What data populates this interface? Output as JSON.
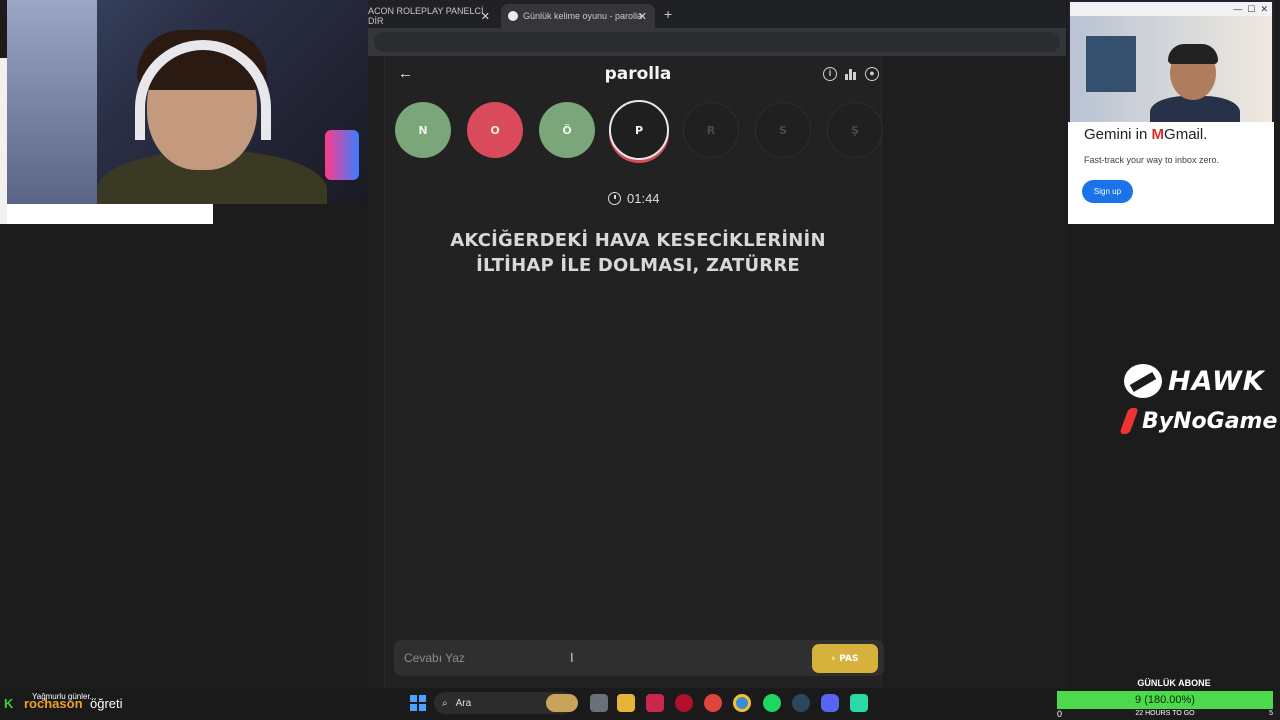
{
  "browser": {
    "tabs": [
      {
        "label": "ACON ROLEPLAY PANELCİ DİR"
      },
      {
        "label": "Günlük kelime oyunu - parolla"
      }
    ],
    "new_tab": "+"
  },
  "game": {
    "title": "parolla",
    "letters": [
      {
        "char": "N",
        "state": "correct"
      },
      {
        "char": "O",
        "state": "wrong"
      },
      {
        "char": "Ö",
        "state": "correct"
      },
      {
        "char": "P",
        "state": "current"
      },
      {
        "char": "R",
        "state": "pending"
      },
      {
        "char": "S",
        "state": "pending"
      },
      {
        "char": "Ş",
        "state": "pending"
      }
    ],
    "timer": "01:44",
    "question_line1": "AKCİĞERDEKİ HAVA KESECİKLERİNİN",
    "question_line2": "İLTİHAP İLE DOLMASI, ZATÜRRE",
    "answer_placeholder": "Cevabı Yaz",
    "pass_label": "PAS"
  },
  "ad": {
    "headline_prefix": "Gemini in ",
    "headline_brand": "Gmail.",
    "sub": "Fast-track your way to inbox zero.",
    "button": "Sign up"
  },
  "sponsors": {
    "hawk": "HAWK",
    "bynogame": "ByNoGame"
  },
  "subgoal": {
    "label": "GÜNLÜK ABONE",
    "value": "9 (180.00%)",
    "min": "0",
    "center": "22 HOURS TO GO",
    "max": "5",
    "progress": 1.0
  },
  "ticker": {
    "badge": "K",
    "small": "Yağmurlu günler...",
    "name": "rochason",
    "word": "öğreti"
  },
  "taskbar": {
    "search": "Ara"
  },
  "colors": {
    "correct": "#7aa67a",
    "wrong": "#d94a5a",
    "pass": "#d6b23c"
  }
}
